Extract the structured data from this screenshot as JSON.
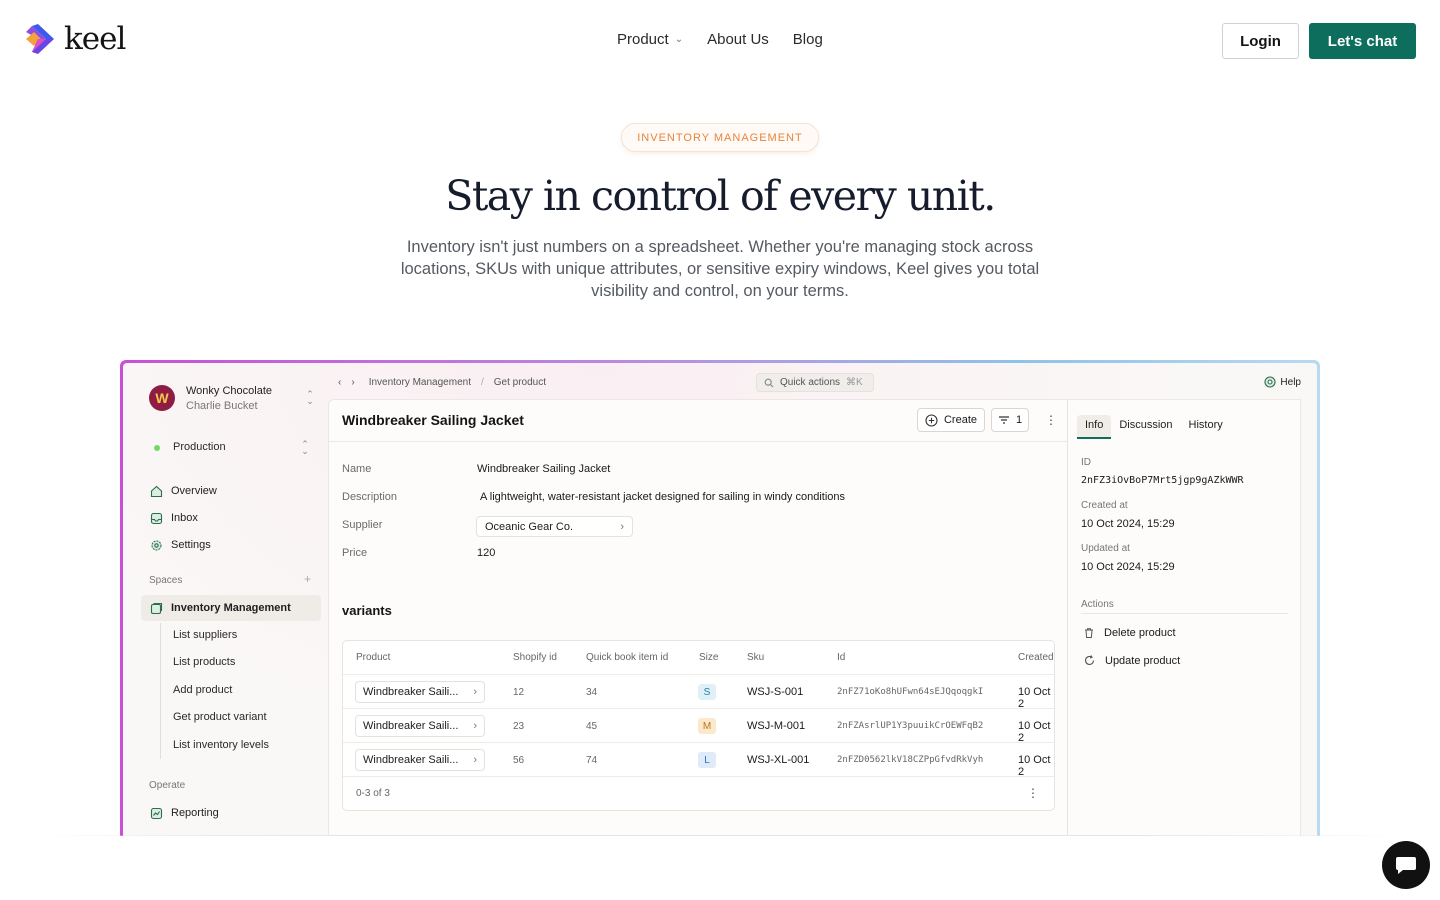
{
  "nav": {
    "logo_text": "keel",
    "links": [
      "Product",
      "About Us",
      "Blog"
    ],
    "login": "Login",
    "cta": "Let's chat"
  },
  "hero": {
    "eyebrow": "INVENTORY MANAGEMENT",
    "title": "Stay in control of every unit.",
    "subtitle": "Inventory isn't just numbers on a spreadsheet. Whether you're managing stock across locations, SKUs with unique attributes, or sensitive expiry windows, Keel gives you total visibility and control, on your terms."
  },
  "app": {
    "org": {
      "initial": "W",
      "name": "Wonky Chocolate",
      "user": "Charlie Bucket"
    },
    "environment": "Production",
    "sidebar": {
      "top_items": [
        "Overview",
        "Inbox",
        "Settings"
      ],
      "spaces_heading": "Spaces",
      "space": "Inventory Management",
      "space_items": [
        "List suppliers",
        "List products",
        "Add product",
        "Get product variant",
        "List inventory levels"
      ],
      "operate_heading": "Operate",
      "operate_items": [
        "Reporting"
      ]
    },
    "topbar": {
      "breadcrumb": [
        "Inventory Management",
        "Get product"
      ],
      "quick_actions": "Quick actions",
      "shortcut": "⌘K",
      "help": "Help"
    },
    "record": {
      "title": "Windbreaker Sailing Jacket",
      "create_label": "Create",
      "filter_count": "1",
      "fields": {
        "name_label": "Name",
        "name": "Windbreaker Sailing Jacket",
        "description_label": "Description",
        "description": "A lightweight, water-resistant jacket designed for sailing in windy conditions",
        "supplier_label": "Supplier",
        "supplier": "Oceanic Gear Co.",
        "price_label": "Price",
        "price": "120"
      },
      "variants_heading": "variants",
      "table": {
        "columns": [
          "Product",
          "Shopify id",
          "Quick book item id",
          "Size",
          "Sku",
          "Id",
          "Created"
        ],
        "rows": [
          {
            "product": "Windbreaker Saili...",
            "shopify": "12",
            "quickbook": "34",
            "size": "S",
            "sku": "WSJ-S-001",
            "id": "2nFZ71oKo8hUFwn64sEJQqoqgkI",
            "created": "10 Oct 2"
          },
          {
            "product": "Windbreaker Saili...",
            "shopify": "23",
            "quickbook": "45",
            "size": "M",
            "sku": "WSJ-M-001",
            "id": "2nFZAsrlUP1Y3puuikCrOEWFqB2",
            "created": "10 Oct 2"
          },
          {
            "product": "Windbreaker Saili...",
            "shopify": "56",
            "quickbook": "74",
            "size": "L",
            "sku": "WSJ-XL-001",
            "id": "2nFZD0562lkV18CZPpGfvdRkVyh",
            "created": "10 Oct 2"
          }
        ],
        "footer": "0-3 of 3"
      }
    },
    "details": {
      "tabs": [
        "Info",
        "Discussion",
        "History"
      ],
      "id_label": "ID",
      "id": "2nFZ3iOvBoP7Mrt5jgp9gAZkWWR",
      "created_label": "Created at",
      "created": "10 Oct 2024, 15:29",
      "updated_label": "Updated at",
      "updated": "10 Oct 2024, 15:29",
      "actions_heading": "Actions",
      "actions": [
        "Delete product",
        "Update product"
      ]
    }
  },
  "colors": {
    "brand_green": "#0d6e5e",
    "eyebrow_orange": "#e8843c",
    "avatar_bg": "#8e1c43",
    "size_s": "#dff1f7",
    "size_m": "#fbe9c9",
    "size_l": "#e0ebfa"
  }
}
